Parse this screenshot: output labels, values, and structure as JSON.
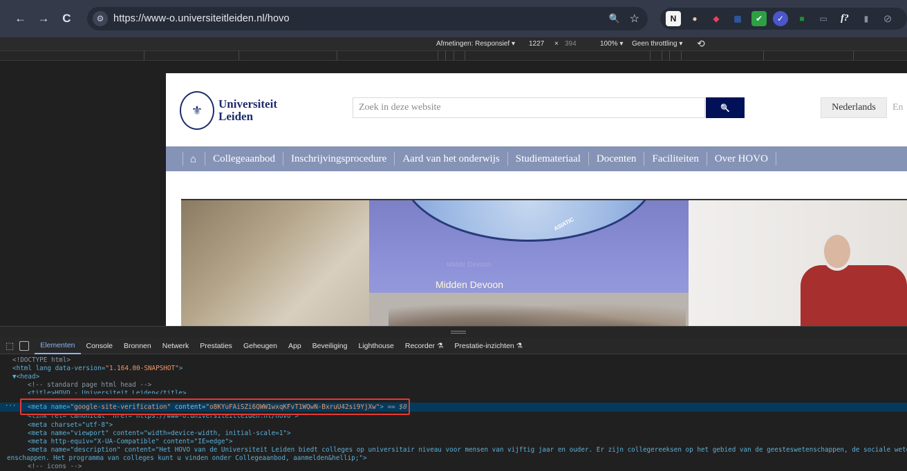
{
  "browser": {
    "back_icon": "←",
    "forward_icon": "→",
    "reload_icon": "C",
    "site_info_icon": "⚙",
    "url": "https://www-o.universiteitleiden.nl/hovo",
    "zoom_icon": "🔍",
    "bookmark_icon": "☆",
    "extensions": [
      "N",
      "●",
      "◆",
      "▦",
      "✔",
      "✓",
      "■",
      "▭",
      "f?",
      "▮",
      "⊘"
    ]
  },
  "device_toolbar": {
    "dimensions_label": "Afmetingen: Responsief ▾",
    "width": "1227",
    "times": "×",
    "height": "394",
    "zoom": "100% ▾",
    "throttling": "Geen throttling ▾",
    "rotate_icon": "⟲"
  },
  "site": {
    "logo_line1": "Universiteit",
    "logo_line2": "Leiden",
    "search_placeholder": "Zoek in deze website",
    "search_icon": "🔍",
    "lang_nl": "Nederlands",
    "lang_en": "En",
    "nav_home_icon": "⌂",
    "nav": [
      "Collegeaanbod",
      "Inschrijvingsprocedure",
      "Aard van het onderwijs",
      "Studiemateriaal",
      "Docenten",
      "Faciliteiten",
      "Over HOVO"
    ],
    "hero": {
      "caption_small": "Midde Devoon",
      "caption": "Midden Devoon",
      "globe_label": "ASIATIC"
    }
  },
  "devtools": {
    "tabs": [
      "Elementen",
      "Console",
      "Bronnen",
      "Netwerk",
      "Prestaties",
      "Geheugen",
      "App",
      "Beveiliging",
      "Lighthouse",
      "Recorder ⚗",
      "Prestatie-inzichten ⚗"
    ],
    "active_tab": "Elementen",
    "lines": {
      "doctype": "<!DOCTYPE html>",
      "html_tag": "<html lang data-version=",
      "html_version": "\"1.164.00-SNAPSHOT\"",
      "html_close": ">",
      "head": "▼<head>",
      "comment_head": "<!-- standard page html head -->",
      "title_line": "<title>HOVO - Universiteit Leiden</title>",
      "meta_google_attr": "<meta name=",
      "meta_google_name": "\"google-site-verification\"",
      "meta_google_content_attr": " content=",
      "meta_google_content": "\"o8KYuFAiSZi6QWW1wxqKFvT1WQwN-BxruU42si9YjXw\"",
      "meta_google_close": ">",
      "meta_google_selected": " == $0",
      "link_canonical": "<link rel=\"canonical\" href=\"https://www-o.universiteitleiden.nl/hovo\">",
      "meta_charset": "<meta charset=\"utf-8\">",
      "meta_viewport": "<meta name=\"viewport\" content=\"width=device-width, initial-scale=1\">",
      "meta_compat": "<meta http-equiv=\"X-UA-Compatible\" content=\"IE=edge\">",
      "meta_desc_1": "<meta name=\"description\" content=\"Het HOVO van de Universiteit Leiden biedt colleges op universitair niveau voor mensen van vijftig jaar en ouder. Er zijn collegereeksen op het gebied van de geesteswetenschappen, de sociale wetensch",
      "meta_desc_2": "enschappen. Het programma van colleges kunt u vinden onder Collegeaanbod, aanmelden&hellip;\">",
      "comment_icons": "<!-- icons -->"
    }
  }
}
